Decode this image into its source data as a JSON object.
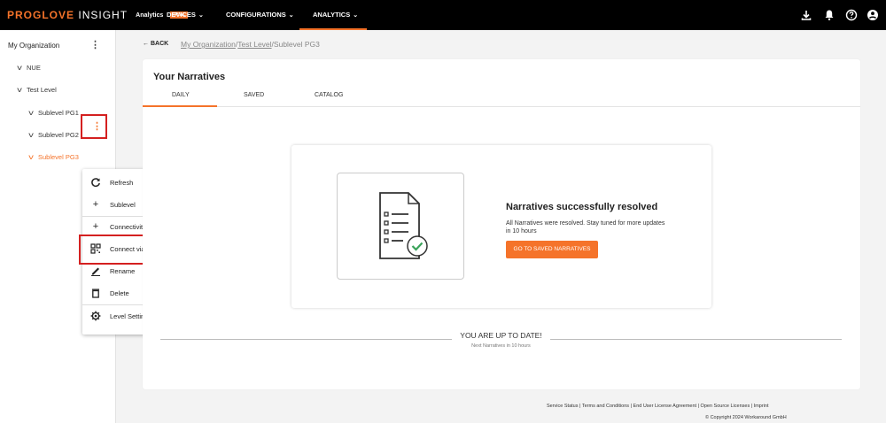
{
  "header": {
    "brand_primary": "PROGLOVE",
    "brand_secondary": "INSIGHT",
    "brand_product": "Analytics",
    "brand_badge": "TRIAL",
    "nav": [
      {
        "label": "DEVICES",
        "icon": "chevron-down-icon"
      },
      {
        "label": "CONFIGURATIONS",
        "icon": "chevron-down-icon"
      },
      {
        "label": "ANALYTICS",
        "icon": "chevron-down-icon"
      }
    ],
    "active_nav": "ANALYTICS",
    "icons": [
      "download-icon",
      "bell-icon",
      "help-icon",
      "gear-icon",
      "user-icon"
    ]
  },
  "sidebar": {
    "org_label": "My Organization",
    "items": [
      {
        "label": "NUE",
        "active": false
      },
      {
        "label": "Test Level",
        "active": false
      },
      {
        "label": "Sublevel PG1",
        "active": false
      },
      {
        "label": "Sublevel PG2",
        "active": false
      },
      {
        "label": "Sublevel PG3",
        "active": true
      }
    ]
  },
  "context_menu": {
    "items": [
      {
        "label": "Refresh",
        "icon": "refresh-icon"
      },
      {
        "label": "Sublevel",
        "icon": "plus-icon"
      },
      {
        "label": "Connectivity Device",
        "icon": "plus-icon"
      },
      {
        "label": "Connect via QR Code",
        "icon": "qr-code-icon"
      },
      {
        "label": "Rename",
        "icon": "edit-icon"
      },
      {
        "label": "Delete",
        "icon": "trash-icon"
      },
      {
        "label": "Level Settings",
        "icon": "gear-icon"
      }
    ],
    "highlighted": "Connect via QR Code"
  },
  "breadcrumb": {
    "back_label": "BACK",
    "path": [
      "My Organization",
      "Test Level",
      "Sublevel PG3"
    ],
    "separator": "/"
  },
  "narratives": {
    "title": "Your Narratives",
    "tabs": [
      "DAILY",
      "SAVED",
      "CATALOG"
    ],
    "active_tab": "DAILY",
    "success_title": "Narratives successfully resolved",
    "success_body": "All Narratives were resolved. Stay tuned for more updates in 10 hours",
    "goto_button": "GO TO SAVED NARRATIVES",
    "up_to_date": "YOU ARE UP TO DATE!",
    "next_text": "Next Narratives in 10 hours"
  },
  "footer": {
    "links": "Service Status | Terms and Conditions | End User License Agreement | Open Source Licenses | Imprint",
    "copyright": "© Copyright 2024 Workaround GmbH"
  },
  "colors": {
    "accent": "#f5732a",
    "highlight_border": "#d42020",
    "topbar": "#000000",
    "check_green": "#3aa35a"
  }
}
